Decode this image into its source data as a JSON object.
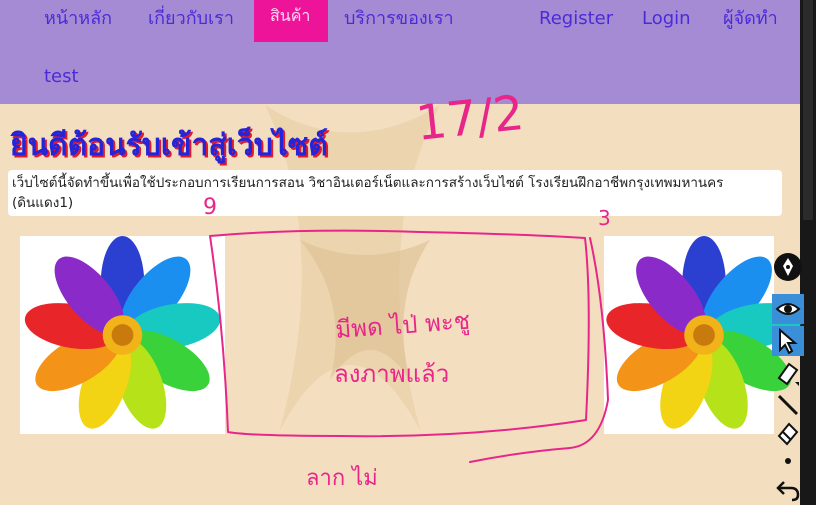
{
  "nav": {
    "items": [
      "หน้าหลัก",
      "เกี่ยวกับเรา",
      "สินค้า",
      "บริการของเรา",
      "test"
    ],
    "active": "สินค้า",
    "right": [
      "Register",
      "Login",
      "ผู้จัดทำ"
    ]
  },
  "main": {
    "title": "ยินดีต้อนรับเข้าสู่เว็บไซต์",
    "description": "เว็บไซต์นี้จัดทำขึ้นเพื่อใช้ประกอบการเรียนการสอน วิชาอินเตอร์เน็ตและการสร้างเว็บไซต์ โรงเรียนฝึกอาชีพกรุงเทพมหานคร (ดินแดง1)"
  },
  "annotations": {
    "handwriting": [
      "17/2",
      "9",
      "3",
      "มีพด ไป่ พะชู",
      "ลงภาพแล้ว",
      "ลาก ไม่"
    ]
  },
  "colors": {
    "navbar": "#a58bd3",
    "nav_text": "#4b2bd8",
    "active_tab": "#ee1499",
    "page_bg": "#f3dfc0",
    "title": "#2424d8",
    "title_shadow": "#e01a2c",
    "ink": "#e8268a"
  },
  "toolbar": {
    "tools": [
      "pen-icon",
      "eye-icon",
      "pointer-icon",
      "highlighter-icon",
      "line-icon",
      "eraser-icon",
      "dot-icon",
      "undo-icon"
    ]
  }
}
